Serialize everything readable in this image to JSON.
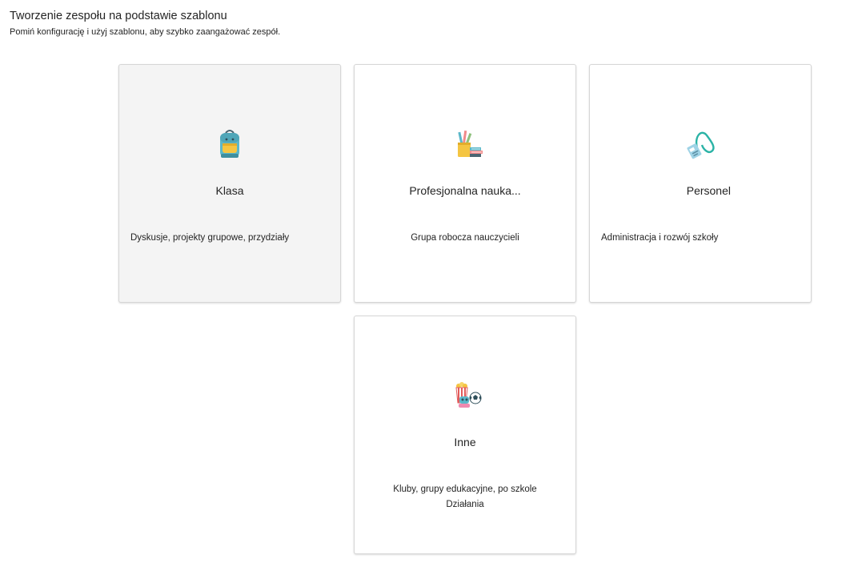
{
  "page": {
    "title": "Tworzenie zespołu na podstawie szablonu",
    "subtitle": "Pomiń konfigurację i użyj szablonu, aby szybko zaangażować zespół."
  },
  "cards": [
    {
      "icon": "backpack-icon",
      "title": "Klasa",
      "description": "Dyskusje, projekty grupowe, przydziały"
    },
    {
      "icon": "books-pencils-icon",
      "title": "Profesjonalna nauka...",
      "description": "Grupa robocza nauczycieli"
    },
    {
      "icon": "lanyard-badge-icon",
      "title": "Personel",
      "description": "Administracja i rozwój szkoły"
    },
    {
      "icon": "popcorn-ball-icon",
      "title": "Inne",
      "description_line1": "Kluby, grupy edukacyjne, po szkole",
      "description_line2": "Działania"
    }
  ],
  "colors": {
    "card_hover_bg": "#f4f4f4",
    "card_border": "#d6d6d6",
    "text": "#242424"
  }
}
